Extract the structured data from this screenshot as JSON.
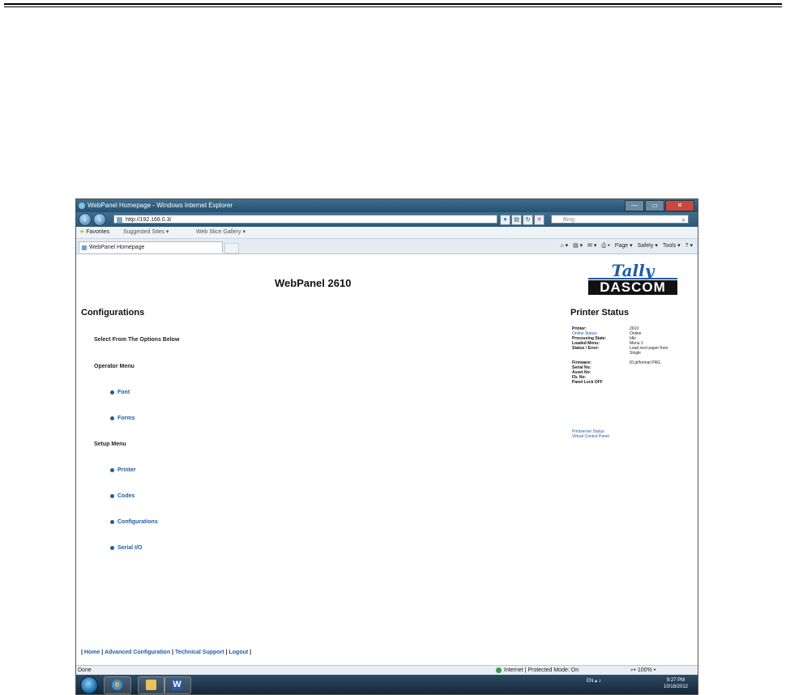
{
  "window": {
    "title": "WebPanel Homepage - Windows Internet Explorer",
    "url": "http://192.168.0.3/",
    "search_placeholder": "Bing",
    "favorites_label": "Favorites",
    "suggested_sites": "Suggested Sites ▾",
    "web_slice_gallery": "Web Slice Gallery ▾",
    "tab_label": "WebPanel Homepage",
    "command_bar": [
      "Page ▾",
      "Safety ▾",
      "Tools ▾"
    ],
    "window_buttons": [
      "—",
      "▭",
      "✕"
    ]
  },
  "page": {
    "title": "WebPanel 2610",
    "logo_top": "Tally",
    "logo_bottom": "DASCOM",
    "configurations_heading": "Configurations",
    "select_options": "Select From The Options Below",
    "operator_menu": "Operator Menu",
    "operator_links": [
      "Font",
      "Forms"
    ],
    "setup_menu": "Setup Menu",
    "setup_links": [
      "Printer",
      "Codes",
      "Configurations",
      "Serial I/O"
    ],
    "printer_status_heading": "Printer Status",
    "status": {
      "printer_k": "Printer:",
      "printer_v": "2610",
      "online_k": "Online Status:",
      "online_v": "Online",
      "processing_k": "Processing State:",
      "processing_v": "Idle",
      "loaded_k": "Loaded Menu:",
      "loaded_v": "Menu 1",
      "error_k": "Status / Error:",
      "error_v1": "Load next paper from",
      "error_v2": "Single",
      "firmware_k": "Firmware:",
      "firmware_v": "ID.pl/format PRG",
      "serial_k": "Serial No:",
      "asset_k": "Asset No:",
      "fb_k": "Fb. No:",
      "panel_k": "Panel Lock OFF"
    },
    "status_links": [
      "Printserver Status",
      "Virtual Control Panel"
    ],
    "footer_links": [
      "Home",
      "Advanced Configuration",
      "Technical Support",
      "Logout"
    ]
  },
  "statusbar": {
    "done": "Done",
    "zone": "Internet | Protected Mode: On",
    "zoom": "100%"
  },
  "taskbar": {
    "lang": "EN",
    "time": "9:27 PM",
    "date": "10/18/2012"
  }
}
